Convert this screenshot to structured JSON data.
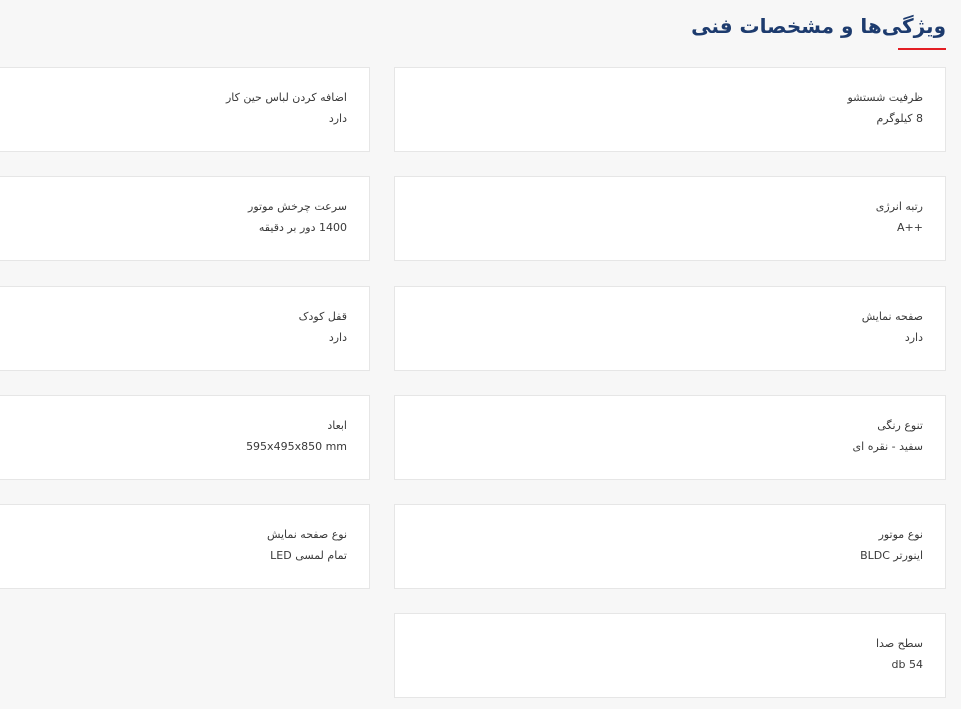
{
  "section": {
    "title": "ویژگی‌ها و مشخصات فنی"
  },
  "specs_right": [
    {
      "label": "ظرفیت شستشو",
      "value": "8 کیلوگرم"
    },
    {
      "label": "رتبه انرژی",
      "value": "A++"
    },
    {
      "label": "صفحه نمایش",
      "value": "دارد"
    },
    {
      "label": "تنوع رنگی",
      "value": "سفید - نقره ای"
    },
    {
      "label": "نوع موتور",
      "value": "اینورتر BLDC"
    },
    {
      "label": "سطح صدا",
      "value": "54 db"
    }
  ],
  "specs_left": [
    {
      "label": "اضافه کردن لباس حین کار",
      "value": "دارد"
    },
    {
      "label": "سرعت چرخش موتور",
      "value": "1400 دور بر دقیقه"
    },
    {
      "label": "قفل کودک",
      "value": "دارد"
    },
    {
      "label": "ابعاد",
      "value": "595x495x850 mm"
    },
    {
      "label": "نوع صفحه نمایش",
      "value": "تمام لمسی LED"
    }
  ]
}
